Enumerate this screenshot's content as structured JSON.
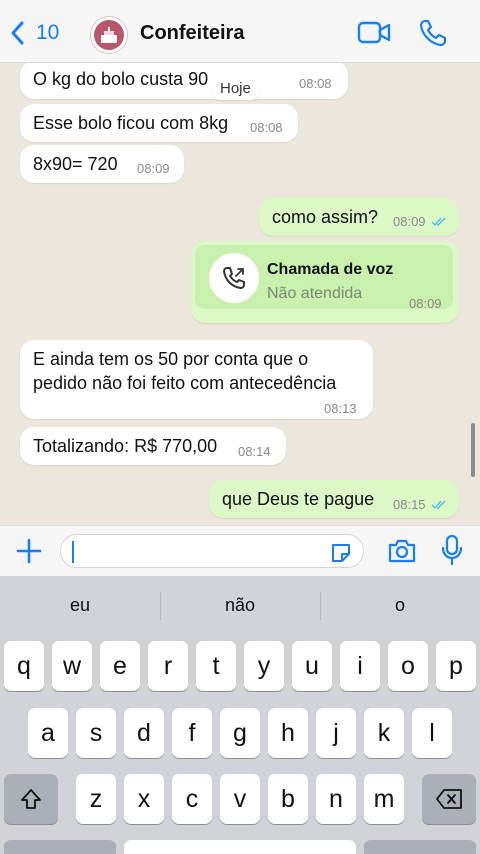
{
  "header": {
    "back_count": "10",
    "contact_name": "Confeiteira",
    "icons": [
      "chevron-left-icon",
      "avatar",
      "video-call-icon",
      "phone-icon"
    ]
  },
  "chat": {
    "day_label": "Hoje",
    "messages": [
      {
        "direction": "in",
        "text": "O kg do bolo custa 90",
        "time": "08:08"
      },
      {
        "direction": "in",
        "text": "Esse bolo ficou com 8kg",
        "time": "08:08"
      },
      {
        "direction": "in",
        "text": "8x90= 720",
        "time": "08:09"
      },
      {
        "direction": "out",
        "text": "como assim?",
        "time": "08:09",
        "status": "read"
      },
      {
        "direction": "out",
        "type": "call",
        "title": "Chamada de voz",
        "subtitle": "Não atendida",
        "time": "08:09"
      },
      {
        "direction": "in",
        "line1": "E ainda tem os 50 por conta que o",
        "line2": "pedido não foi feito com antecedência",
        "time": "08:13"
      },
      {
        "direction": "in",
        "text": "Totalizando: R$ 770,00",
        "time": "08:14"
      },
      {
        "direction": "out",
        "text": "que Deus te pague",
        "time": "08:15",
        "status": "read"
      }
    ]
  },
  "input": {
    "value": "",
    "icons": [
      "plus-icon",
      "sticker-icon",
      "camera-icon",
      "microphone-icon"
    ]
  },
  "keyboard": {
    "suggestions": [
      "eu",
      "não",
      "o"
    ],
    "row1": [
      "q",
      "w",
      "e",
      "r",
      "t",
      "y",
      "u",
      "i",
      "o",
      "p"
    ],
    "row2": [
      "a",
      "s",
      "d",
      "f",
      "g",
      "h",
      "j",
      "k",
      "l"
    ],
    "row3": [
      "z",
      "x",
      "c",
      "v",
      "b",
      "n",
      "m"
    ]
  },
  "colors": {
    "accent": "#147efb",
    "outgoing_bubble": "#dbf8c6",
    "incoming_bubble": "#ffffff",
    "read_ticks": "#53bdeb"
  }
}
